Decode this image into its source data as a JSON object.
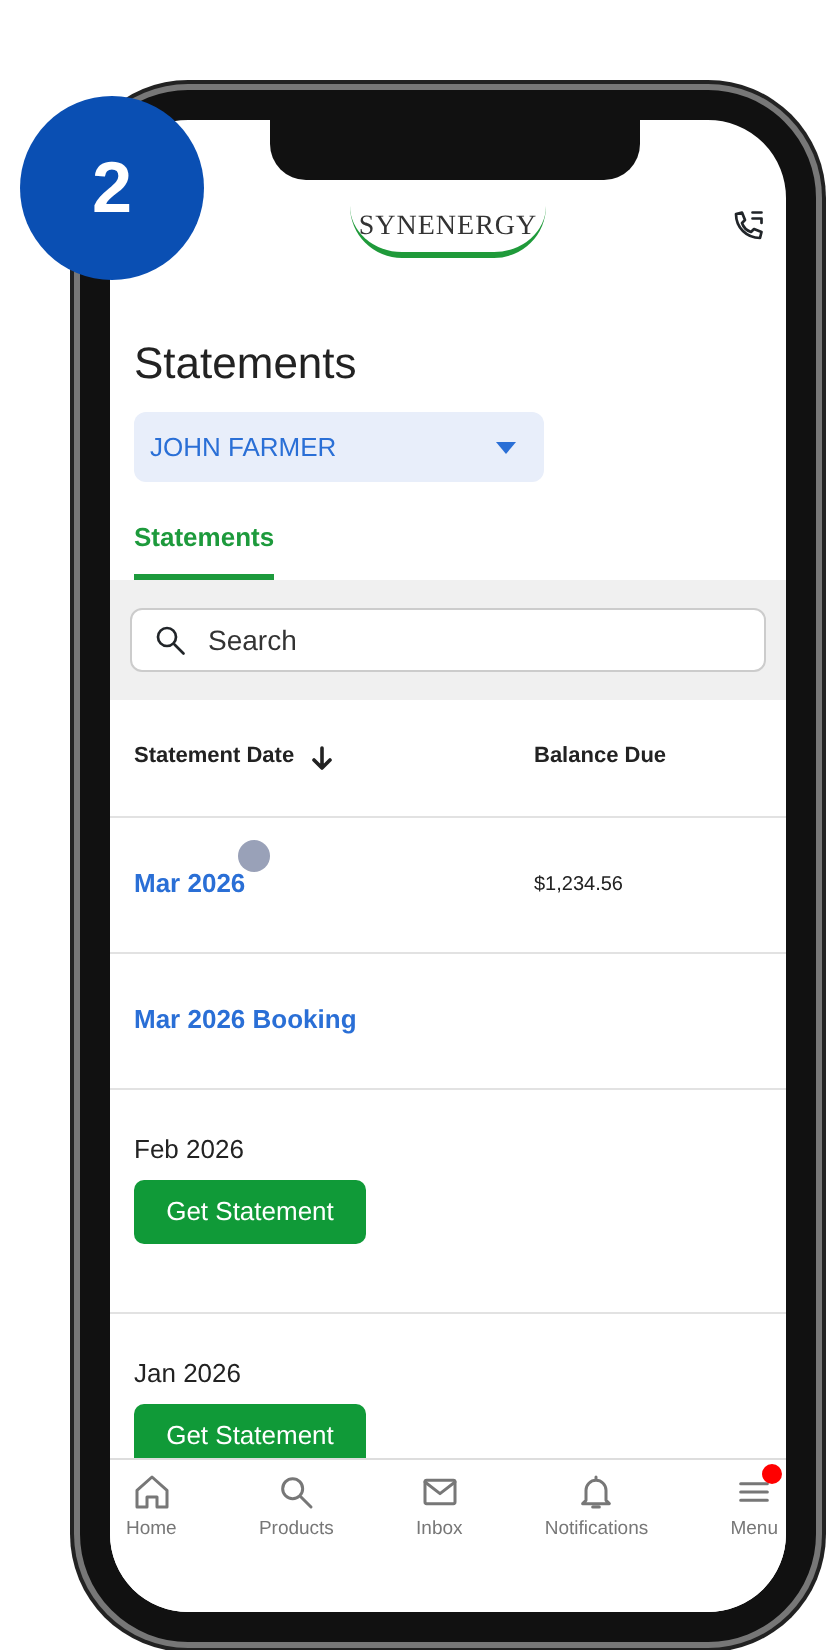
{
  "badge": "2",
  "header": {
    "logo": "SYNENERGY"
  },
  "title": "Statements",
  "account_select": {
    "value": "JOHN FARMER"
  },
  "tabs": [
    {
      "label": "Statements",
      "selected": true
    }
  ],
  "search": {
    "placeholder": "Search"
  },
  "table": {
    "columns": [
      "Statement Date",
      "Balance Due"
    ],
    "rows": [
      {
        "kind": "link",
        "date": "Mar 2026",
        "balance": "$1,234.56"
      },
      {
        "kind": "link",
        "date": "Mar 2026 Booking"
      },
      {
        "kind": "button",
        "date": "Feb 2026",
        "action": "Get Statement"
      },
      {
        "kind": "button",
        "date": "Jan 2026",
        "action": "Get Statement"
      }
    ]
  },
  "bottom_nav": [
    {
      "label": "Home",
      "kind": "home",
      "notification": false
    },
    {
      "label": "Products",
      "kind": "search",
      "notification": false
    },
    {
      "label": "Inbox",
      "kind": "mail",
      "notification": false
    },
    {
      "label": "Notifications",
      "kind": "bell",
      "notification": false
    },
    {
      "label": "Menu",
      "kind": "menu",
      "notification": true
    }
  ]
}
